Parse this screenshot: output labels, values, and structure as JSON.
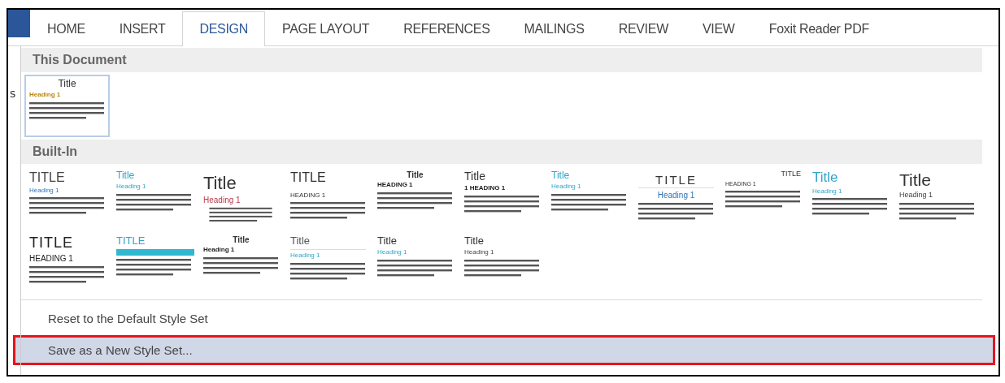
{
  "ribbon_tabs": [
    {
      "label": "HOME",
      "selected": false
    },
    {
      "label": "INSERT",
      "selected": false
    },
    {
      "label": "DESIGN",
      "selected": true
    },
    {
      "label": "PAGE LAYOUT",
      "selected": false
    },
    {
      "label": "REFERENCES",
      "selected": false
    },
    {
      "label": "MAILINGS",
      "selected": false
    },
    {
      "label": "REVIEW",
      "selected": false
    },
    {
      "label": "VIEW",
      "selected": false
    },
    {
      "label": "Foxit Reader PDF",
      "selected": false
    }
  ],
  "side_fragment": "s",
  "sections": [
    {
      "header": "This Document",
      "items": [
        {
          "kind": "gold",
          "title": "Title",
          "heading": "Heading 1",
          "selected": true
        }
      ]
    },
    {
      "header": "Built-In",
      "items": [
        {
          "kind": "caps-blue",
          "title": "TITLE",
          "heading": "Heading 1",
          "selected": false
        },
        {
          "kind": "teal",
          "title": "Title",
          "heading": "Heading 1",
          "selected": false
        },
        {
          "kind": "large-red",
          "title": "Title",
          "heading": "Heading 1",
          "selected": false
        },
        {
          "kind": "caps-dark",
          "title": "TITLE",
          "heading": "HEADING 1",
          "selected": false
        },
        {
          "kind": "bold-center",
          "title": "Title",
          "heading": "HEADING 1",
          "selected": false
        },
        {
          "kind": "numbered",
          "title": "Title",
          "heading": "1 HEADING 1",
          "selected": false
        },
        {
          "kind": "teal",
          "title": "Title",
          "heading": "Heading 1",
          "selected": false
        },
        {
          "kind": "centered",
          "title": "TITLE",
          "heading": "Heading 1",
          "selected": false
        },
        {
          "kind": "right",
          "title": "TITLE",
          "heading": "HEADING 1",
          "selected": false
        },
        {
          "kind": "teal-large",
          "title": "Title",
          "heading": "Heading 1",
          "selected": false
        },
        {
          "kind": "large-dark",
          "title": "Title",
          "heading": "Heading 1",
          "selected": false
        },
        {
          "kind": "caps-big",
          "title": "TITLE",
          "heading": "HEADING 1",
          "selected": false
        },
        {
          "kind": "banner",
          "title": "TITLE",
          "selected": false
        },
        {
          "kind": "bold-center",
          "title": "Title",
          "heading": "Heading 1",
          "selected": false
        },
        {
          "kind": "rule",
          "title": "Title",
          "heading": "Heading 1",
          "selected": false
        },
        {
          "kind": "teal-heading",
          "title": "Title",
          "heading": "Heading 1",
          "selected": false
        },
        {
          "kind": "plain",
          "title": "Title",
          "heading": "Heading 1",
          "selected": false
        }
      ]
    }
  ],
  "menu_items": [
    {
      "label": "Reset to the Default Style Set",
      "selected": false
    },
    {
      "label": "Save as a New Style Set...",
      "selected": true
    }
  ]
}
